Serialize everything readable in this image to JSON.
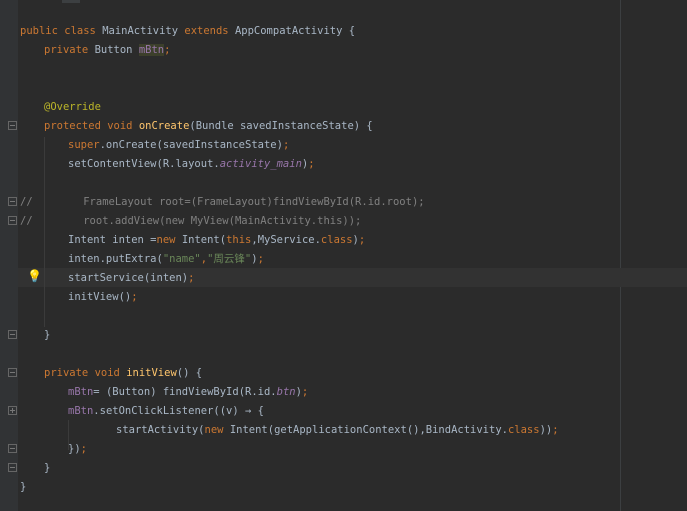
{
  "editor": {
    "lines": [
      {
        "segments": [
          [
            "kw",
            "public class "
          ],
          [
            "",
            "MainActivity "
          ],
          [
            "kw",
            "extends "
          ],
          [
            "",
            "AppCompatActivity {"
          ]
        ]
      },
      {
        "segments": [
          [
            "kw",
            "private "
          ],
          [
            "",
            "Button "
          ],
          [
            "field hl",
            "mBtn"
          ],
          [
            "kw",
            ";"
          ]
        ]
      },
      {
        "segments": [
          [
            "ann",
            "@Override"
          ]
        ]
      },
      {
        "segments": [
          [
            "kw",
            "protected void "
          ],
          [
            "fn",
            "onCreate"
          ],
          [
            "",
            "(Bundle savedInstanceState) {"
          ]
        ]
      },
      {
        "segments": [
          [
            "kw",
            "super"
          ],
          [
            "",
            ".onCreate(savedInstanceState)"
          ],
          [
            "kw",
            ";"
          ]
        ]
      },
      {
        "segments": [
          [
            "",
            "setContentView(R.layout."
          ],
          [
            "ital",
            "activity_main"
          ],
          [
            "",
            ")"
          ],
          [
            "kw",
            ";"
          ]
        ]
      },
      {
        "segments": [
          [
            "cmt",
            "//"
          ],
          [
            "cmt",
            "        FrameLayout root=(FrameLayout)findViewById(R.id.root);"
          ]
        ]
      },
      {
        "segments": [
          [
            "cmt",
            "//"
          ],
          [
            "cmt",
            "        root.addView(new MyView(MainActivity.this));"
          ]
        ]
      },
      {
        "segments": [
          [
            "",
            "Intent inten ="
          ],
          [
            "kw",
            "new "
          ],
          [
            "",
            "Intent("
          ],
          [
            "kw",
            "this"
          ],
          [
            "",
            ",MyService."
          ],
          [
            "kw",
            "class"
          ],
          [
            "",
            ")"
          ],
          [
            "kw",
            ";"
          ]
        ]
      },
      {
        "segments": [
          [
            "",
            "inten.putExtra("
          ],
          [
            "str",
            "\"name\""
          ],
          [
            "kw",
            ","
          ],
          [
            "str",
            "\"周云锋\""
          ],
          [
            "",
            ")"
          ],
          [
            "kw",
            ";"
          ]
        ]
      },
      {
        "segments": [
          [
            "",
            "startService(inten)"
          ],
          [
            "kw",
            ";"
          ]
        ]
      },
      {
        "segments": [
          [
            "",
            "initView()"
          ],
          [
            "kw",
            ";"
          ]
        ]
      },
      {
        "segments": [
          [
            "",
            "}"
          ]
        ]
      },
      {
        "segments": [
          [
            "kw",
            "private void "
          ],
          [
            "fn",
            "initView"
          ],
          [
            "",
            "() {"
          ]
        ]
      },
      {
        "segments": [
          [
            "field",
            "mBtn"
          ],
          [
            "",
            "= (Button) findViewById(R.id."
          ],
          [
            "ital",
            "btn"
          ],
          [
            "",
            ")"
          ],
          [
            "kw",
            ";"
          ]
        ]
      },
      {
        "segments": [
          [
            "field",
            "mBtn"
          ],
          [
            "",
            ".setOnClickListener((v) → {"
          ]
        ]
      },
      {
        "segments": [
          [
            "",
            "startActivity("
          ],
          [
            "kw",
            "new "
          ],
          [
            "",
            "Intent(getApplicationContext(),BindActivity."
          ],
          [
            "kw",
            "class"
          ],
          [
            "",
            "))"
          ],
          [
            "kw",
            ";"
          ]
        ]
      },
      {
        "segments": [
          [
            "",
            "})"
          ],
          [
            "kw",
            ";"
          ]
        ]
      },
      {
        "segments": [
          [
            "",
            "}"
          ]
        ]
      },
      {
        "segments": [
          [
            "",
            "}"
          ]
        ]
      }
    ]
  }
}
